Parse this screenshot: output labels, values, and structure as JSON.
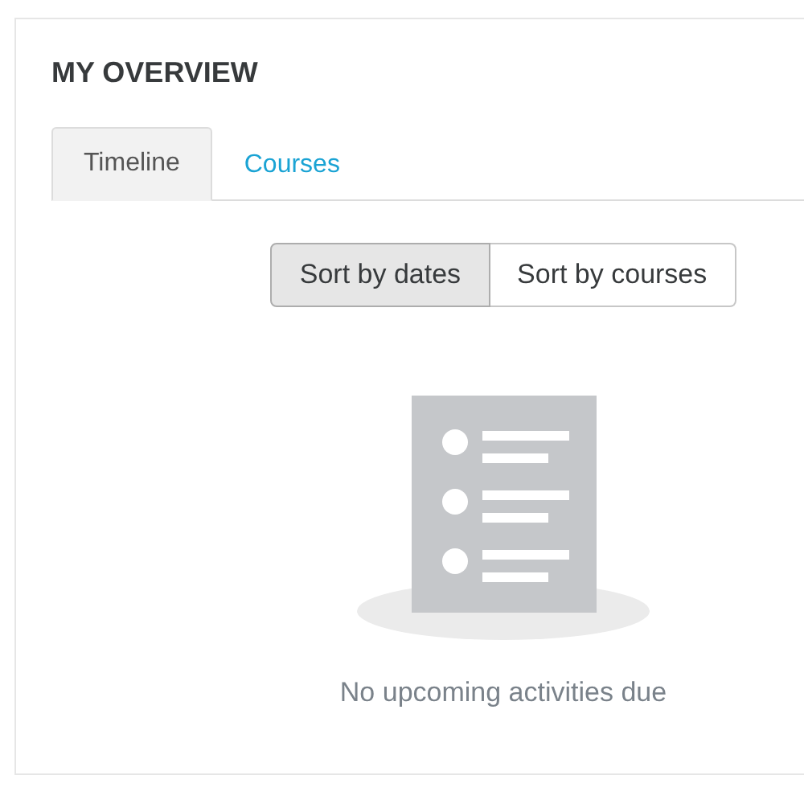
{
  "block": {
    "title": "MY OVERVIEW"
  },
  "tabs": [
    {
      "label": "Timeline",
      "selected": true
    },
    {
      "label": "Courses",
      "selected": false
    }
  ],
  "sort_buttons": [
    {
      "label": "Sort by dates",
      "selected": true
    },
    {
      "label": "Sort by courses",
      "selected": false
    }
  ],
  "empty_state": {
    "message": "No upcoming activities due"
  }
}
